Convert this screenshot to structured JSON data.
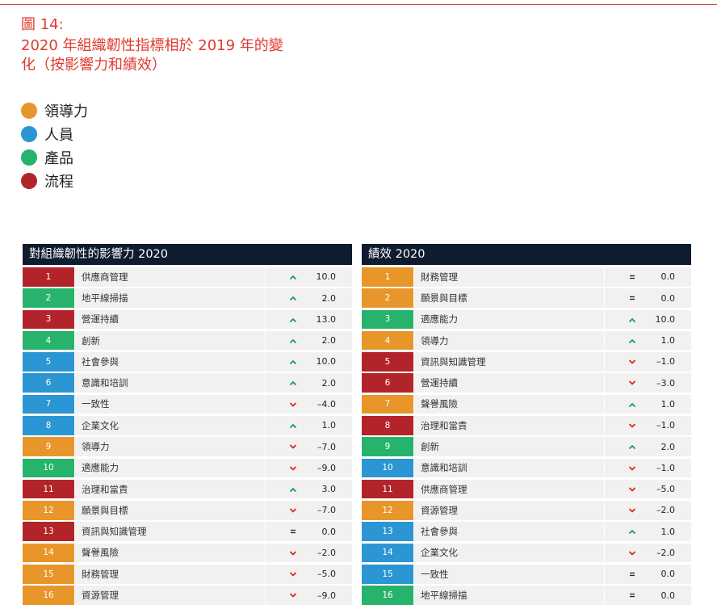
{
  "figure": {
    "label": "圖 14:",
    "title": "2020 年組織韌性指標相於 2019 年的變化（按影響力和績效）"
  },
  "colors": {
    "leadership": "#e8962a",
    "people": "#2b96d3",
    "product": "#27b36b",
    "process": "#b3242a",
    "header_bg": "#0f1b2e",
    "up": "#1a9a62",
    "down": "#d62a22"
  },
  "legend": [
    {
      "key": "leadership",
      "label": "領導力"
    },
    {
      "key": "people",
      "label": "人員"
    },
    {
      "key": "product",
      "label": "產品"
    },
    {
      "key": "process",
      "label": "流程"
    }
  ],
  "chart_data": [
    {
      "type": "table",
      "title": "對組織韌性的影響力 2020",
      "columns": [
        "rank",
        "indicator",
        "change_direction",
        "change"
      ],
      "rows": [
        {
          "rank": "1",
          "name": "供應商管理",
          "category": "process",
          "dir": "up",
          "value": "10.0"
        },
        {
          "rank": "2",
          "name": "地平線掃描",
          "category": "product",
          "dir": "up",
          "value": "2.0"
        },
        {
          "rank": "3",
          "name": "營運持續",
          "category": "process",
          "dir": "up",
          "value": "13.0"
        },
        {
          "rank": "4",
          "name": "創新",
          "category": "product",
          "dir": "up",
          "value": "2.0"
        },
        {
          "rank": "5",
          "name": "社會參與",
          "category": "people",
          "dir": "up",
          "value": "10.0"
        },
        {
          "rank": "6",
          "name": "意識和培訓",
          "category": "people",
          "dir": "up",
          "value": "2.0"
        },
        {
          "rank": "7",
          "name": "一致性",
          "category": "people",
          "dir": "down",
          "value": "–4.0"
        },
        {
          "rank": "8",
          "name": "企業文化",
          "category": "people",
          "dir": "up",
          "value": "1.0"
        },
        {
          "rank": "9",
          "name": "領導力",
          "category": "leadership",
          "dir": "down",
          "value": "–7.0"
        },
        {
          "rank": "10",
          "name": "適應能力",
          "category": "product",
          "dir": "down",
          "value": "–9.0"
        },
        {
          "rank": "11",
          "name": "治理和當責",
          "category": "process",
          "dir": "up",
          "value": "3.0"
        },
        {
          "rank": "12",
          "name": "願景與目標",
          "category": "leadership",
          "dir": "down",
          "value": "–7.0"
        },
        {
          "rank": "13",
          "name": "資訊與知識管理",
          "category": "process",
          "dir": "equal",
          "value": "0.0"
        },
        {
          "rank": "14",
          "name": "聲譽風險",
          "category": "leadership",
          "dir": "down",
          "value": "–2.0"
        },
        {
          "rank": "15",
          "name": "財務管理",
          "category": "leadership",
          "dir": "down",
          "value": "–5.0"
        },
        {
          "rank": "16",
          "name": "資源管理",
          "category": "leadership",
          "dir": "down",
          "value": "–9.0"
        }
      ]
    },
    {
      "type": "table",
      "title": "績效 2020",
      "columns": [
        "rank",
        "indicator",
        "change_direction",
        "change"
      ],
      "rows": [
        {
          "rank": "1",
          "name": "財務管理",
          "category": "leadership",
          "dir": "equal",
          "value": "0.0"
        },
        {
          "rank": "2",
          "name": "願景與目標",
          "category": "leadership",
          "dir": "equal",
          "value": "0.0"
        },
        {
          "rank": "3",
          "name": "適應能力",
          "category": "product",
          "dir": "up",
          "value": "10.0"
        },
        {
          "rank": "4",
          "name": "領導力",
          "category": "leadership",
          "dir": "up",
          "value": "1.0"
        },
        {
          "rank": "5",
          "name": "資訊與知識管理",
          "category": "process",
          "dir": "down",
          "value": "–1.0"
        },
        {
          "rank": "6",
          "name": "營運持續",
          "category": "process",
          "dir": "down",
          "value": "–3.0"
        },
        {
          "rank": "7",
          "name": "聲譽風險",
          "category": "leadership",
          "dir": "up",
          "value": "1.0"
        },
        {
          "rank": "8",
          "name": "治理和當責",
          "category": "process",
          "dir": "down",
          "value": "–1.0"
        },
        {
          "rank": "9",
          "name": "創新",
          "category": "product",
          "dir": "up",
          "value": "2.0"
        },
        {
          "rank": "10",
          "name": "意識和培訓",
          "category": "people",
          "dir": "down",
          "value": "–1.0"
        },
        {
          "rank": "11",
          "name": "供應商管理",
          "category": "process",
          "dir": "down",
          "value": "–5.0"
        },
        {
          "rank": "12",
          "name": "資源管理",
          "category": "leadership",
          "dir": "down",
          "value": "–2.0"
        },
        {
          "rank": "13",
          "name": "社會參與",
          "category": "people",
          "dir": "up",
          "value": "1.0"
        },
        {
          "rank": "14",
          "name": "企業文化",
          "category": "people",
          "dir": "down",
          "value": "–2.0"
        },
        {
          "rank": "15",
          "name": "一致性",
          "category": "people",
          "dir": "equal",
          "value": "0.0"
        },
        {
          "rank": "16",
          "name": "地平線掃描",
          "category": "product",
          "dir": "equal",
          "value": "0.0"
        }
      ]
    }
  ]
}
